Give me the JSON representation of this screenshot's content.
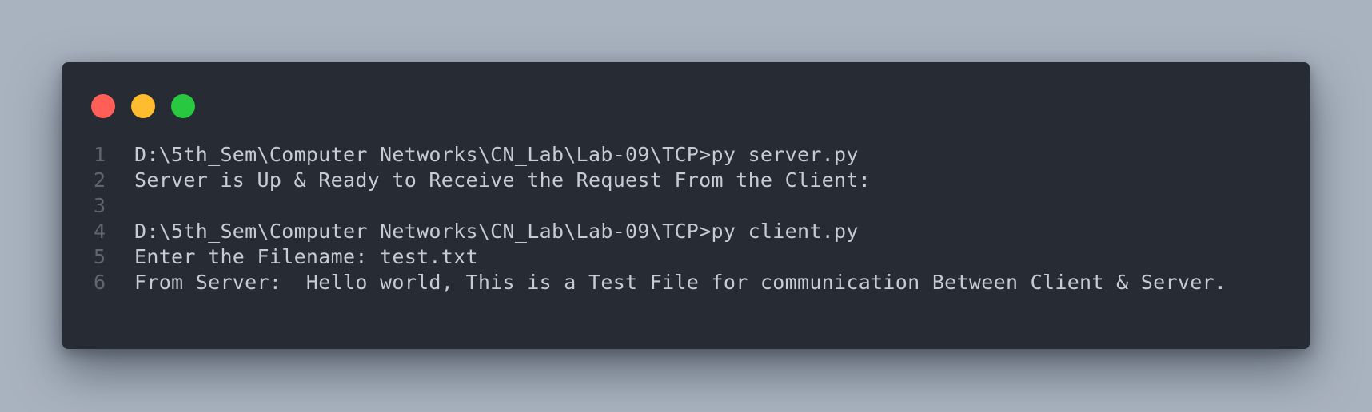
{
  "window": {
    "controls": [
      {
        "name": "close",
        "color": "#ff5f57"
      },
      {
        "name": "minimize",
        "color": "#febc2e"
      },
      {
        "name": "zoom",
        "color": "#28c840"
      }
    ]
  },
  "code": {
    "lines": [
      {
        "number": "1",
        "text": "D:\\5th_Sem\\Computer Networks\\CN_Lab\\Lab-09\\TCP>py server.py"
      },
      {
        "number": "2",
        "text": "Server is Up & Ready to Receive the Request From the Client:"
      },
      {
        "number": "3",
        "text": ""
      },
      {
        "number": "4",
        "text": "D:\\5th_Sem\\Computer Networks\\CN_Lab\\Lab-09\\TCP>py client.py"
      },
      {
        "number": "5",
        "text": "Enter the Filename: test.txt"
      },
      {
        "number": "6",
        "text": "From Server:  Hello world, This is a Test File for communication Between Client & Server."
      }
    ]
  }
}
